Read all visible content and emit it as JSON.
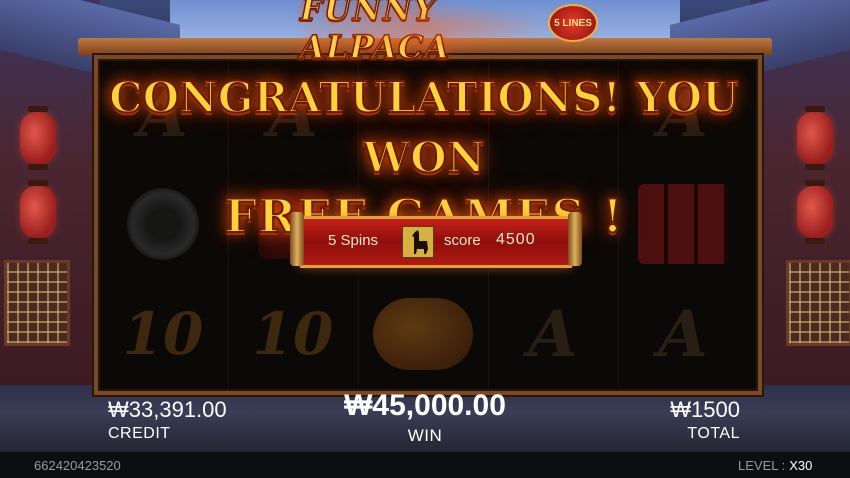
{
  "game": {
    "logo_text": "FUNNY ALPACA",
    "lines_badge": "5 LINES"
  },
  "banner": {
    "line1": "CONGRATULATIONS! YOU WON",
    "line2": "FREE GAMES !"
  },
  "free_games": {
    "spins": "5 Spins",
    "score_label": "score",
    "score_value": "4500",
    "icon": "alpaca-icon"
  },
  "reels": {
    "columns": [
      [
        "A",
        "gong",
        "10"
      ],
      [
        "A",
        "firecracker",
        "10"
      ],
      [
        "",
        "",
        "money-bag"
      ],
      [
        "",
        "",
        "A"
      ],
      [
        "A",
        "firecracker-bundle",
        "A"
      ]
    ]
  },
  "hud": {
    "credit_value": "₩33,391.00",
    "credit_label": "CREDIT",
    "win_value": "₩45,000.00",
    "win_label": "WIN",
    "total_value": "₩1500",
    "total_label": "TOTAL",
    "round_id": "662420423520",
    "level_label": "LEVEL :",
    "level_value": "X30"
  },
  "colors": {
    "headline": "#ffd23a",
    "scroll": "#c4221a",
    "frame": "#7a4a24"
  }
}
